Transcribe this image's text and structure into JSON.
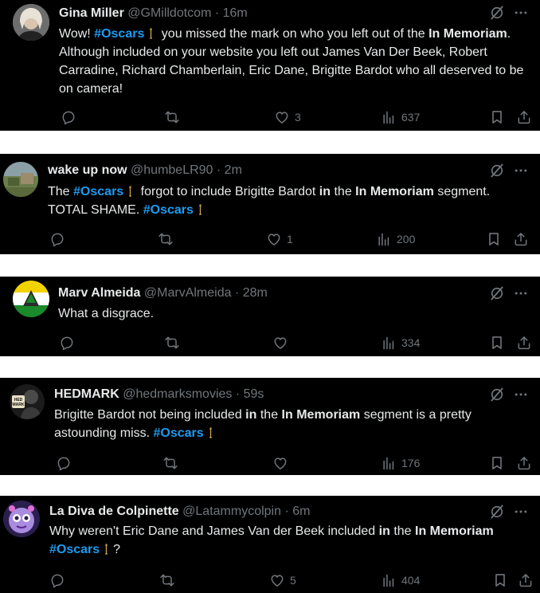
{
  "accent_color": "#1d9bf0",
  "tweets": [
    {
      "name": "Gina Miller",
      "handle": "@GMilldotcom",
      "time": "16m",
      "avatar": "person-photo",
      "text": {
        "p1": "Wow!",
        "tag1": "#Oscars",
        "p2": "you missed the mark on who you left out of the",
        "bold1": "In Memoriam",
        "p3": ". Although included on your website you left out James Van Der Beek, Robert Carradine, Richard Chamberlain, Eric Dane, Brigitte Bardot who all deserved to be on camera!"
      },
      "replies": "",
      "retweets": "",
      "likes": "3",
      "views": "637"
    },
    {
      "name": "wake up now",
      "handle": "@humbeLR90",
      "time": "2m",
      "avatar": "landscape-photo",
      "text": {
        "p1": "The",
        "tag1": "#Oscars",
        "p2": "forgot to include Brigitte Bardot",
        "bold1": "in",
        "p3": "the",
        "bold2": "In Memoriam",
        "p4": "segment. TOTAL SHAME.",
        "tag2": "#Oscars"
      },
      "replies": "",
      "retweets": "",
      "likes": "1",
      "views": "200"
    },
    {
      "name": "Marv Almeida",
      "handle": "@MarvAlmeida",
      "time": "28m",
      "avatar": "flag-emblem",
      "text": {
        "p1": "What a disgrace."
      },
      "replies": "",
      "retweets": "",
      "likes": "",
      "views": "334"
    },
    {
      "name": "HEDMARK",
      "handle": "@hedmarksmovies",
      "time": "59s",
      "avatar": "hedmark-logo",
      "text": {
        "p1": "Brigitte Bardot not being included",
        "bold1": "in",
        "p2": "the",
        "bold2": "In Memoriam",
        "p3": "segment is a pretty astounding miss.",
        "tag1": "#Oscars"
      },
      "replies": "",
      "retweets": "",
      "likes": "",
      "views": "176"
    },
    {
      "name": "La Diva de Colpinette",
      "handle": "@Latammycolpin",
      "time": "6m",
      "avatar": "cartoon-creature",
      "text": {
        "p1": "Why weren't Eric Dane and James Van der Beek included",
        "bold1": "in",
        "p2": "the",
        "bold2": "In Memoriam",
        "tag1": "#Oscars",
        "p3": "?"
      },
      "replies": "",
      "retweets": "",
      "likes": "5",
      "views": "404"
    }
  ]
}
